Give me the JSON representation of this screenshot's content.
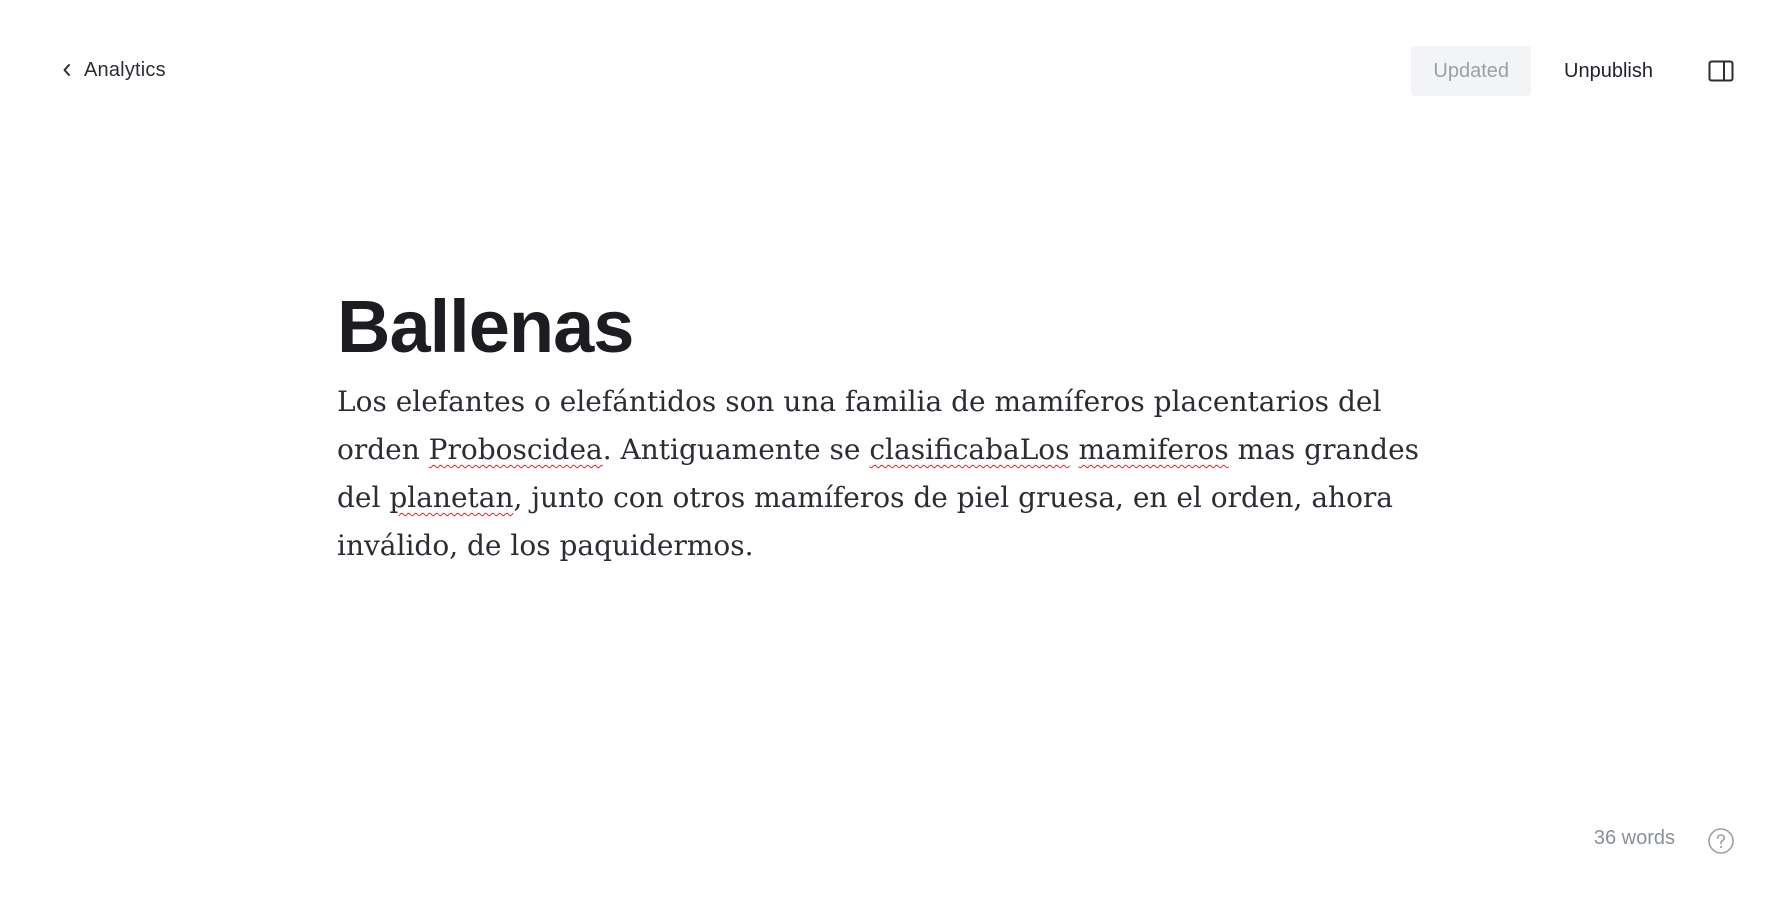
{
  "nav": {
    "back_label": "Analytics",
    "back_icon": "chevron-left-icon"
  },
  "toolbar": {
    "updated_label": "Updated",
    "unpublish_label": "Unpublish",
    "panel_icon": "sidebar-toggle-icon"
  },
  "document": {
    "title": "Ballenas",
    "body": [
      {
        "text": "Los elefantes o elefántidos son una familia de mamíferos placentarios del orden ",
        "misspelled": false
      },
      {
        "text": "Proboscidea",
        "misspelled": true
      },
      {
        "text": ". Antiguamente se ",
        "misspelled": false
      },
      {
        "text": "clasificabaLos",
        "misspelled": true
      },
      {
        "text": " ",
        "misspelled": false
      },
      {
        "text": "mamiferos",
        "misspelled": true
      },
      {
        "text": " mas grandes del ",
        "misspelled": false
      },
      {
        "text": "planetan",
        "misspelled": true
      },
      {
        "text": ", junto con otros mamíferos de piel gruesa, en el orden, ahora inválido, de los paquidermos.",
        "misspelled": false
      }
    ],
    "spellcheck_color": "#e0282e"
  },
  "footer": {
    "word_count": "36 words",
    "help_icon": "help-circle-icon"
  }
}
